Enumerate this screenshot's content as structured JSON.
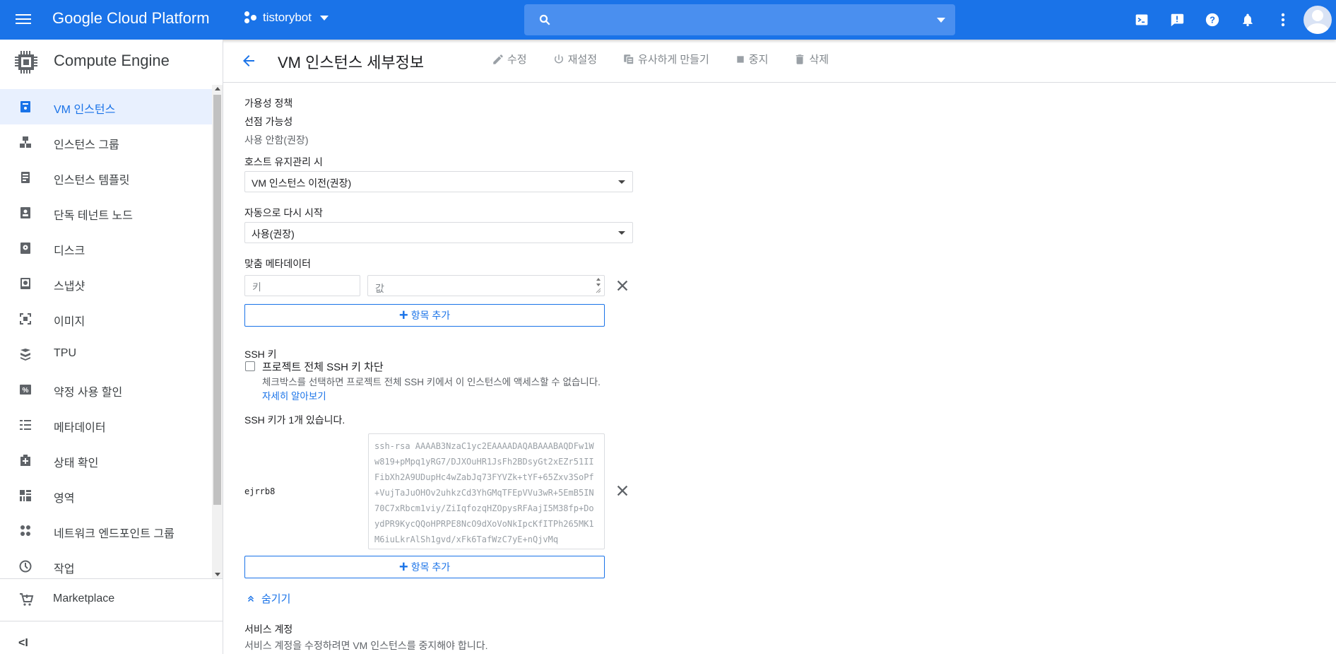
{
  "topbar": {
    "brand": "Google Cloud Platform",
    "project": "tistorybot",
    "search_placeholder": "",
    "icons": [
      "menu-icon",
      "project-icon",
      "search-icon",
      "cloud-shell-icon",
      "feedback-icon",
      "help-icon",
      "notifications-icon",
      "more-vert-icon",
      "account-avatar"
    ]
  },
  "sidebar": {
    "title": "Compute Engine",
    "items": [
      {
        "label": "VM 인스턴스",
        "icon": "vm-instances-icon",
        "active": true
      },
      {
        "label": "인스턴스 그룹",
        "icon": "instance-groups-icon"
      },
      {
        "label": "인스턴스 템플릿",
        "icon": "instance-templates-icon"
      },
      {
        "label": "단독 테넌트 노드",
        "icon": "sole-tenant-nodes-icon"
      },
      {
        "label": "디스크",
        "icon": "disks-icon"
      },
      {
        "label": "스냅샷",
        "icon": "snapshots-icon"
      },
      {
        "label": "이미지",
        "icon": "images-icon"
      },
      {
        "label": "TPU",
        "icon": "tpu-icon"
      },
      {
        "label": "약정 사용 할인",
        "icon": "committed-use-icon"
      },
      {
        "label": "메타데이터",
        "icon": "metadata-icon"
      },
      {
        "label": "상태 확인",
        "icon": "health-checks-icon"
      },
      {
        "label": "영역",
        "icon": "zones-icon"
      },
      {
        "label": "네트워크 엔드포인트 그룹",
        "icon": "network-endpoint-groups-icon"
      },
      {
        "label": "작업",
        "icon": "operations-icon"
      }
    ],
    "marketplace": "Marketplace",
    "collapse_label": "<I"
  },
  "header": {
    "title": "VM 인스턴스 세부정보",
    "actions": {
      "edit": "수정",
      "reset": "재설정",
      "clone": "유사하게 만들기",
      "stop": "중지",
      "delete": "삭제"
    }
  },
  "main": {
    "availability_policy": "가용성 정책",
    "preemptibility_label": "선점 가능성",
    "preemptibility_value": "사용 안함(권장)",
    "host_maintenance_label": "호스트 유지관리 시",
    "host_maintenance_value": "VM 인스턴스 이전(권장)",
    "auto_restart_label": "자동으로 다시 시작",
    "auto_restart_value": "사용(권장)",
    "custom_metadata_label": "맞춤 메타데이터",
    "metadata_key_placeholder": "키",
    "metadata_value_placeholder": "값",
    "add_item": "항목 추가",
    "ssh_keys_label": "SSH 키",
    "block_ssh_label": "프로젝트 전체 SSH 키 차단",
    "block_ssh_desc": "체크박스를 선택하면 프로젝트 전체 SSH 키에서 이 인스턴스에 액세스할 수 없습니다.",
    "learn_more": "자세히 알아보기",
    "ssh_count": "SSH 키가 1개 있습니다.",
    "ssh_user": "ejrrb8",
    "ssh_key": "ssh-rsa AAAAB3NzaC1yc2EAAAADAQABAAABAQDFw1Ww819+pMpq1yRG7/DJXOuHR1JsFh2BDsyGt2xEZr51IIFibXh2A9UDupHc4wZabJq73FYVZk+tYF+65Zxv3SoPf+VujTaJuOHOv2uhkzCd3YhGMqTFEpVVu3wR+5EmB5IN70C7xRbcm1viy/ZiIqfozqHZOpysRFAajI5M38fp+DoydPR9KycQQoHPRPE8NcO9dXoVoNkIpcKfITPh265MK1M6iuLkrAlSh1gvd/xFk6TafWzC7yE+nQjvMq",
    "add_item_2": "항목 추가",
    "hide": "숨기기",
    "service_account_label": "서비스 계정",
    "service_account_desc": "서비스 계정을 수정하려면 VM 인스턴스를 중지해야 합니다."
  }
}
